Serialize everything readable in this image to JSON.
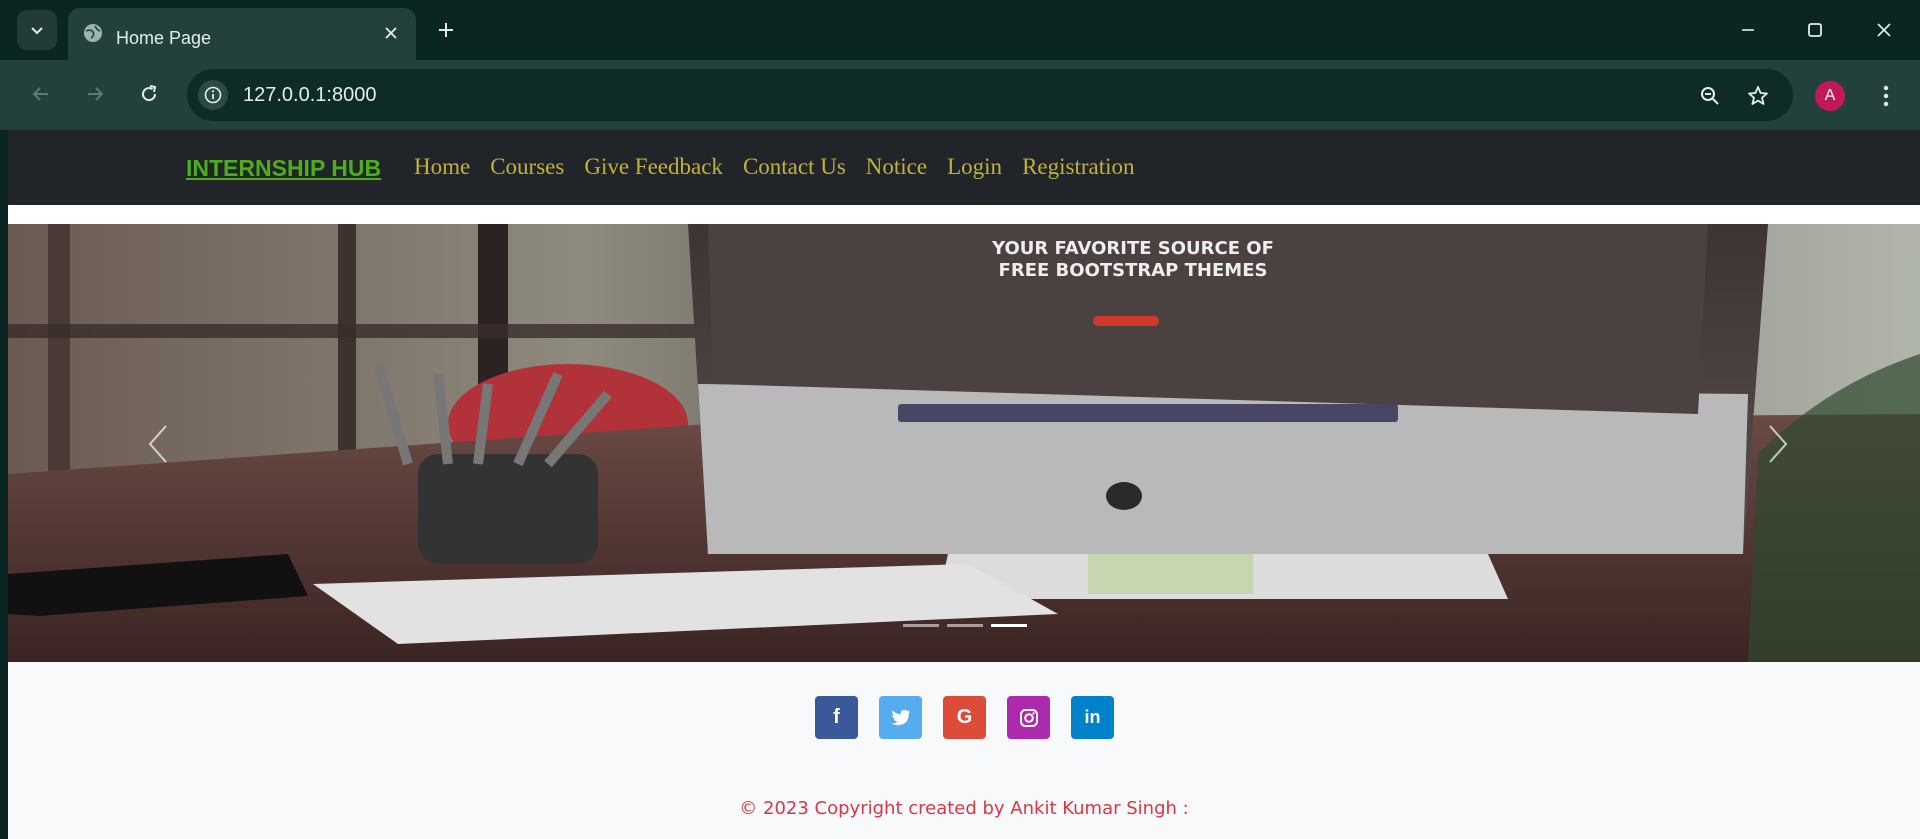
{
  "browser": {
    "tab_title": "Home Page",
    "url": "127.0.0.1:8000",
    "profile_initial": "A"
  },
  "site": {
    "brand": "INTERNSHIP HUB",
    "nav": [
      "Home",
      "Courses",
      "Give Feedback",
      "Contact Us",
      "Notice",
      "Login",
      "Registration"
    ],
    "carousel": {
      "screen_headline_line1": "YOUR FAVORITE SOURCE OF",
      "screen_headline_line2": "FREE BOOTSTRAP THEMES",
      "slide_count": 3,
      "active_slide": 3
    },
    "social": [
      {
        "name": "facebook-icon",
        "glyph": "f",
        "color": "#3b5998"
      },
      {
        "name": "twitter-icon",
        "glyph": "t",
        "color": "#55acee"
      },
      {
        "name": "google-icon",
        "glyph": "G",
        "color": "#dd4b39"
      },
      {
        "name": "instagram-icon",
        "glyph": "◎",
        "color": "#ac2bac"
      },
      {
        "name": "linkedin-icon",
        "glyph": "in",
        "color": "#0082ca"
      }
    ],
    "copyright": "© 2023 Copyright created by Ankit Kumar Singh :"
  },
  "colors": {
    "brand": "#4caf1a",
    "nav_link": "#c0b238",
    "navbar_bg": "#212529",
    "copyright": "#dc3545"
  }
}
